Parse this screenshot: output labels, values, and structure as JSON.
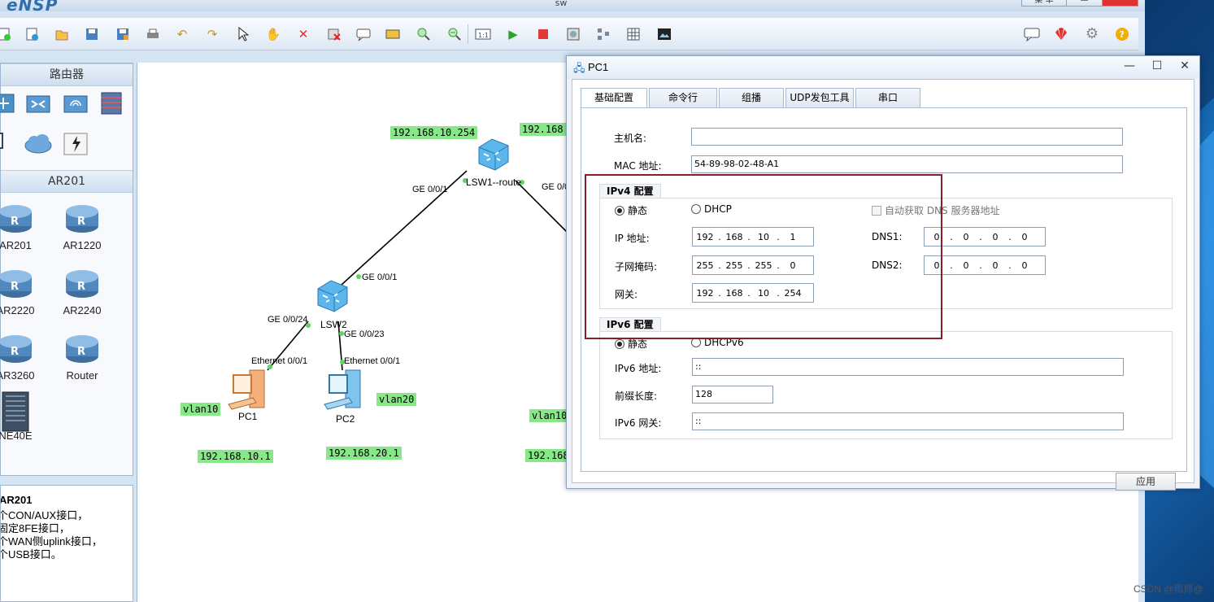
{
  "app": {
    "title": "eNSP",
    "window_caption": "sw",
    "title_buttons": [
      "菜 单",
      "",
      ""
    ]
  },
  "palette": {
    "section_router": "路由器",
    "section_ar201": "AR201",
    "routers": [
      "AR201",
      "AR1220",
      "AR2220",
      "AR2240",
      "AR3260",
      "Router",
      "NE40E"
    ]
  },
  "description": {
    "title": "AR201",
    "lines": [
      "个CON/AUX接口，",
      "固定8FE接口，",
      "个WAN侧uplink接口，",
      "个USB接口。"
    ]
  },
  "topology": {
    "devices": {
      "lsw1": "LSW1--route",
      "lsw2": "LSW2",
      "pc1": "PC1",
      "pc2": "PC2"
    },
    "ports": {
      "lsw1_g1": "GE 0/0/1",
      "lsw1_g2": "GE 0/0/",
      "lsw2_g1": "GE 0/0/1",
      "lsw2_g24": "GE 0/0/24",
      "lsw2_g23": "GE 0/0/23",
      "pc1_eth": "Ethernet 0/0/1",
      "pc2_eth": "Ethernet 0/0/1"
    },
    "labels": {
      "gw_10": "192.168.10.254",
      "gw_cut": "192.168",
      "vlan10": "vlan10",
      "vlan20": "vlan20",
      "vlan10_cut": "vlan10",
      "pc1_ip": "192.168.10.1",
      "pc2_ip": "192.168.20.1",
      "cut_ip": "192.168"
    }
  },
  "dialog": {
    "title": "PC1",
    "tabs": [
      "基础配置",
      "命令行",
      "组播",
      "UDP发包工具",
      "串口"
    ],
    "hostname_label": "主机名:",
    "hostname_value": "",
    "mac_label": "MAC 地址:",
    "mac_value": "54-89-98-02-48-A1",
    "ipv4": {
      "group_title": "IPv4 配置",
      "static_label": "静态",
      "dhcp_label": "DHCP",
      "auto_dns_label": "自动获取 DNS 服务器地址",
      "ip_label": "IP 地址:",
      "ip": [
        "192",
        "168",
        "10",
        "1"
      ],
      "mask_label": "子网掩码:",
      "mask": [
        "255",
        "255",
        "255",
        "0"
      ],
      "gw_label": "网关:",
      "gw": [
        "192",
        "168",
        "10",
        "254"
      ],
      "dns1_label": "DNS1:",
      "dns1": [
        "0",
        "0",
        "0",
        "0"
      ],
      "dns2_label": "DNS2:",
      "dns2": [
        "0",
        "0",
        "0",
        "0"
      ]
    },
    "ipv6": {
      "group_title": "IPv6 配置",
      "static_label": "静态",
      "dhcp_label": "DHCPv6",
      "ip_label": "IPv6 地址:",
      "ip_value": "::",
      "prefix_label": "前缀长度:",
      "prefix_value": "128",
      "gw_label": "IPv6 网关:",
      "gw_value": "::"
    },
    "apply_label": "应用"
  },
  "watermark": "CSDN @雨师@"
}
